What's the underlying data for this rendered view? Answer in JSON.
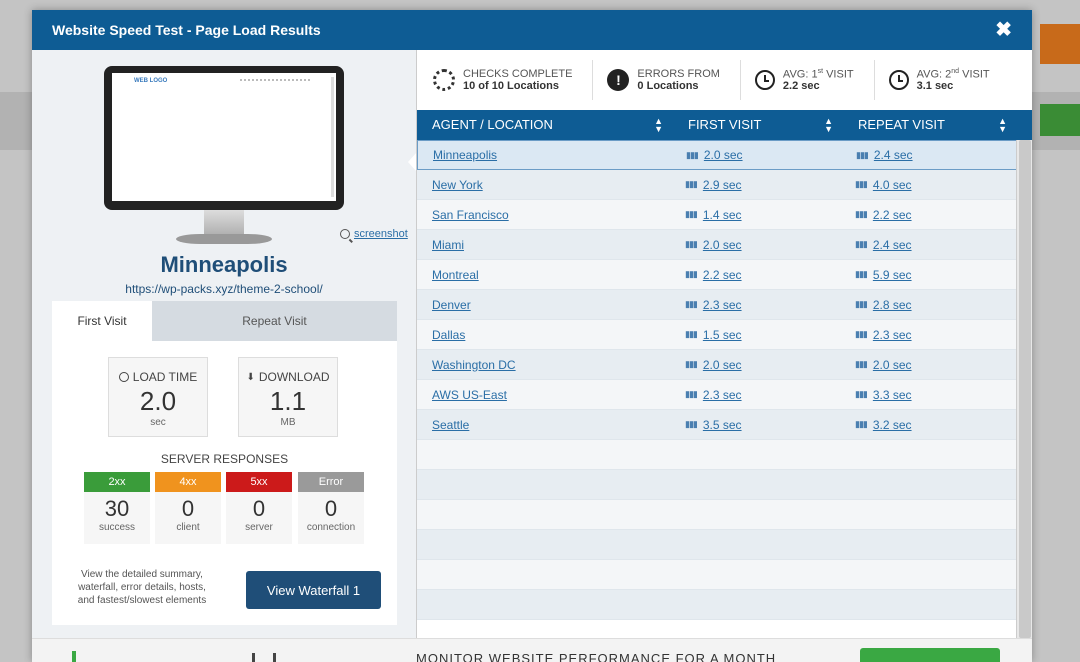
{
  "modal": {
    "title": "Website Speed Test - Page Load Results",
    "close": "✖"
  },
  "preview": {
    "screen_logo": "WEB LOGO",
    "screenshot_label": "screenshot"
  },
  "location": {
    "name": "Minneapolis",
    "url": "https://wp-packs.xyz/theme-2-school/"
  },
  "tabs": [
    {
      "label": "First Visit"
    },
    {
      "label": "Repeat Visit"
    }
  ],
  "metrics": {
    "load": {
      "label": "LOAD TIME",
      "value": "2.0",
      "unit": "sec"
    },
    "download": {
      "label": "DOWNLOAD",
      "value": "1.1",
      "unit": "MB"
    }
  },
  "server": {
    "title": "SERVER RESPONSES",
    "items": [
      {
        "code": "2xx",
        "count": "30",
        "label": "success",
        "color": "#3a9c3a"
      },
      {
        "code": "4xx",
        "count": "0",
        "label": "client",
        "color": "#f0931e"
      },
      {
        "code": "5xx",
        "count": "0",
        "label": "server",
        "color": "#cc1a1a"
      },
      {
        "code": "Error",
        "count": "0",
        "label": "connection",
        "color": "#9a9a9a"
      }
    ]
  },
  "note": "View the detailed summary, waterfall, error details, hosts, and fastest/slowest elements",
  "waterfall_button": "View Waterfall 1",
  "stats": {
    "checks": {
      "label": "CHECKS COMPLETE",
      "value": "10 of 10 Locations"
    },
    "errors": {
      "label": "ERRORS FROM",
      "value": "0 Locations"
    },
    "avg1": {
      "label_pre": "AVG: 1",
      "label_sup": "st",
      "label_post": " VISIT",
      "value": "2.2 sec"
    },
    "avg2": {
      "label_pre": "AVG: 2",
      "label_sup": "nd",
      "label_post": " VISIT",
      "value": "3.1 sec"
    }
  },
  "table": {
    "headers": {
      "location": "AGENT / LOCATION",
      "first": "FIRST VISIT",
      "repeat": "REPEAT VISIT"
    },
    "rows": [
      {
        "location": "Minneapolis",
        "first": "2.0 sec",
        "repeat": "2.4 sec"
      },
      {
        "location": "New York",
        "first": "2.9 sec",
        "repeat": "4.0 sec"
      },
      {
        "location": "San Francisco",
        "first": "1.4 sec",
        "repeat": "2.2 sec"
      },
      {
        "location": "Miami",
        "first": "2.0 sec",
        "repeat": "2.4 sec"
      },
      {
        "location": "Montreal",
        "first": "2.2 sec",
        "repeat": "5.9 sec"
      },
      {
        "location": "Denver",
        "first": "2.3 sec",
        "repeat": "2.8 sec"
      },
      {
        "location": "Dallas",
        "first": "1.5 sec",
        "repeat": "2.3 sec"
      },
      {
        "location": "Washington DC",
        "first": "2.0 sec",
        "repeat": "2.0 sec"
      },
      {
        "location": "AWS US-East",
        "first": "2.3 sec",
        "repeat": "3.3 sec"
      },
      {
        "location": "Seattle",
        "first": "3.5 sec",
        "repeat": "3.2 sec"
      }
    ]
  },
  "footer": {
    "text": "MONITOR WEBSITE PERFORMANCE FOR A MONTH"
  }
}
